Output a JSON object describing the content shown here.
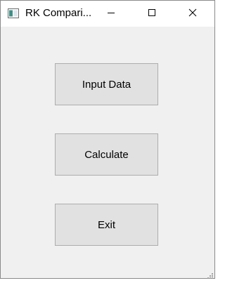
{
  "window": {
    "title": "RK Compari...",
    "icons": {
      "app": "app-window-icon",
      "minimize": "minimize-icon",
      "maximize": "maximize-icon",
      "close": "close-icon",
      "grip": "resize-grip-icon"
    }
  },
  "buttons": {
    "input_data": "Input Data",
    "calculate": "Calculate",
    "exit": "Exit"
  }
}
